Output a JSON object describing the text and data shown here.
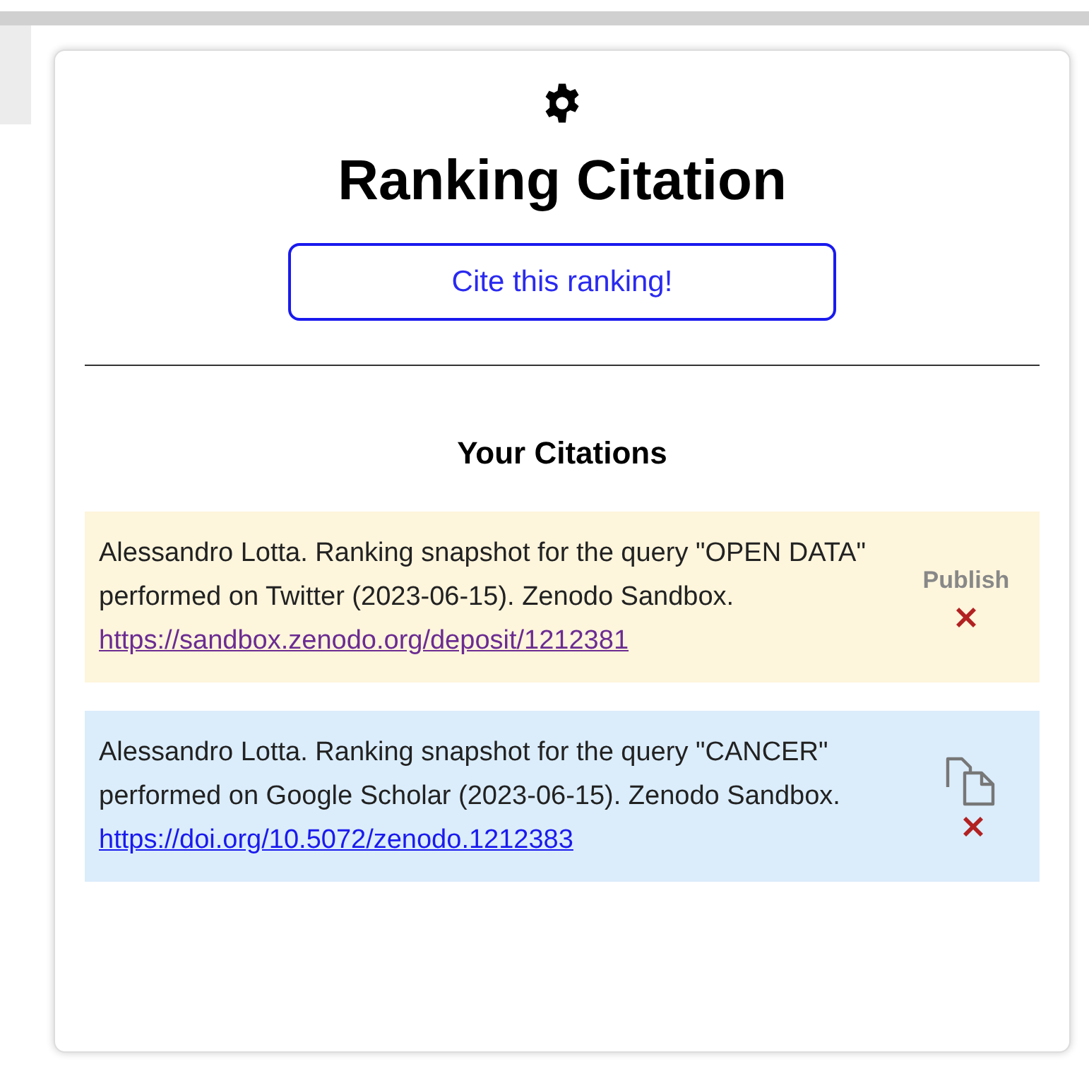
{
  "title": "Ranking Citation",
  "cite_button": "Cite this ranking!",
  "citations_heading": "Your Citations",
  "citations": [
    {
      "kind": "draft",
      "text": "Alessandro Lotta. Ranking snapshot for the query \"OPEN DATA\" performed on Twitter (2023-06-15). Zenodo Sandbox.",
      "link": "https://sandbox.zenodo.org/deposit/1212381",
      "action": "Publish"
    },
    {
      "kind": "published",
      "text": "Alessandro Lotta. Ranking snapshot for the query \"CANCER\" performed on Google Scholar (2023-06-15). Zenodo Sandbox.",
      "link": "https://doi.org/10.5072/zenodo.1212383"
    }
  ]
}
